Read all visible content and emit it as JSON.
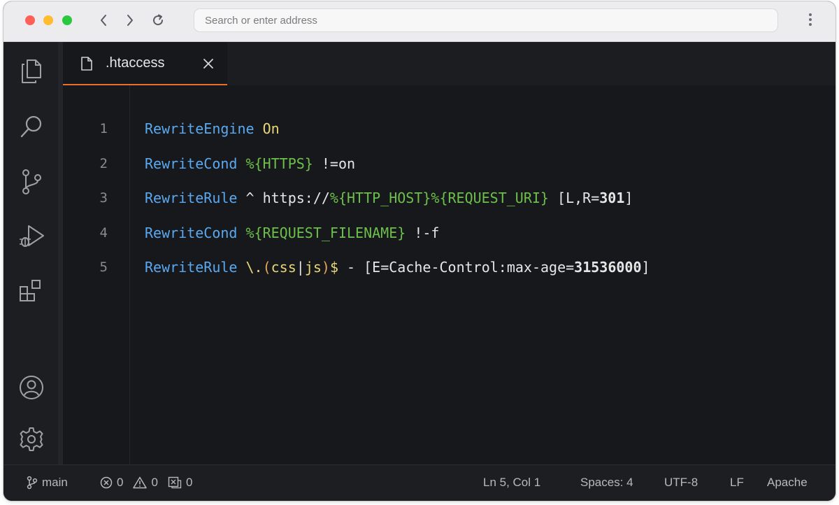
{
  "browser": {
    "address_placeholder": "Search or enter address"
  },
  "editor": {
    "tab": {
      "label": ".htaccess"
    },
    "lines": [
      {
        "number": "1",
        "tokens": [
          {
            "t": "RewriteEngine",
            "c": "dir"
          },
          {
            "t": " ",
            "c": "plain"
          },
          {
            "t": "On",
            "c": "on"
          }
        ]
      },
      {
        "number": "2",
        "tokens": [
          {
            "t": "RewriteCond",
            "c": "dir"
          },
          {
            "t": " ",
            "c": "plain"
          },
          {
            "t": "%{HTTPS}",
            "c": "var"
          },
          {
            "t": " !=on",
            "c": "plain"
          }
        ]
      },
      {
        "number": "3",
        "tokens": [
          {
            "t": "RewriteRule",
            "c": "dir"
          },
          {
            "t": " ^ https://",
            "c": "plain"
          },
          {
            "t": "%{HTTP_HOST}%{REQUEST_URI}",
            "c": "var"
          },
          {
            "t": " [L,R=",
            "c": "plain"
          },
          {
            "t": "301",
            "c": "num"
          },
          {
            "t": "]",
            "c": "plain"
          }
        ]
      },
      {
        "number": "4",
        "tokens": [
          {
            "t": "RewriteCond",
            "c": "dir"
          },
          {
            "t": " ",
            "c": "plain"
          },
          {
            "t": "%{REQUEST_FILENAME}",
            "c": "var"
          },
          {
            "t": " !-f",
            "c": "plain"
          }
        ]
      },
      {
        "number": "5",
        "tokens": [
          {
            "t": "RewriteRule",
            "c": "dir"
          },
          {
            "t": " ",
            "c": "plain"
          },
          {
            "t": "\\.",
            "c": "regex"
          },
          {
            "t": "(",
            "c": "paren"
          },
          {
            "t": "css",
            "c": "regex"
          },
          {
            "t": "|",
            "c": "plain"
          },
          {
            "t": "js",
            "c": "regex"
          },
          {
            "t": ")",
            "c": "paren"
          },
          {
            "t": "$",
            "c": "regex"
          },
          {
            "t": " - [E=Cache-Control:max-age=",
            "c": "plain"
          },
          {
            "t": "31536000",
            "c": "num"
          },
          {
            "t": "]",
            "c": "plain"
          }
        ]
      }
    ]
  },
  "activity_bar": {
    "icons": [
      "files-icon",
      "search-icon",
      "source-control-icon",
      "run-debug-icon",
      "extensions-icon",
      "account-icon",
      "settings-icon"
    ]
  },
  "status": {
    "branch": "main",
    "errors": "0",
    "warnings": "0",
    "ports": "0",
    "position": "Ln 5, Col 1",
    "spaces": "Spaces: 4",
    "encoding": "UTF-8",
    "eol": "LF",
    "language": "Apache"
  },
  "colors": {
    "accent": "#e8702a",
    "directive": "#5aa9f0",
    "variable": "#6cc04a",
    "keyword": "#e8d87a"
  }
}
